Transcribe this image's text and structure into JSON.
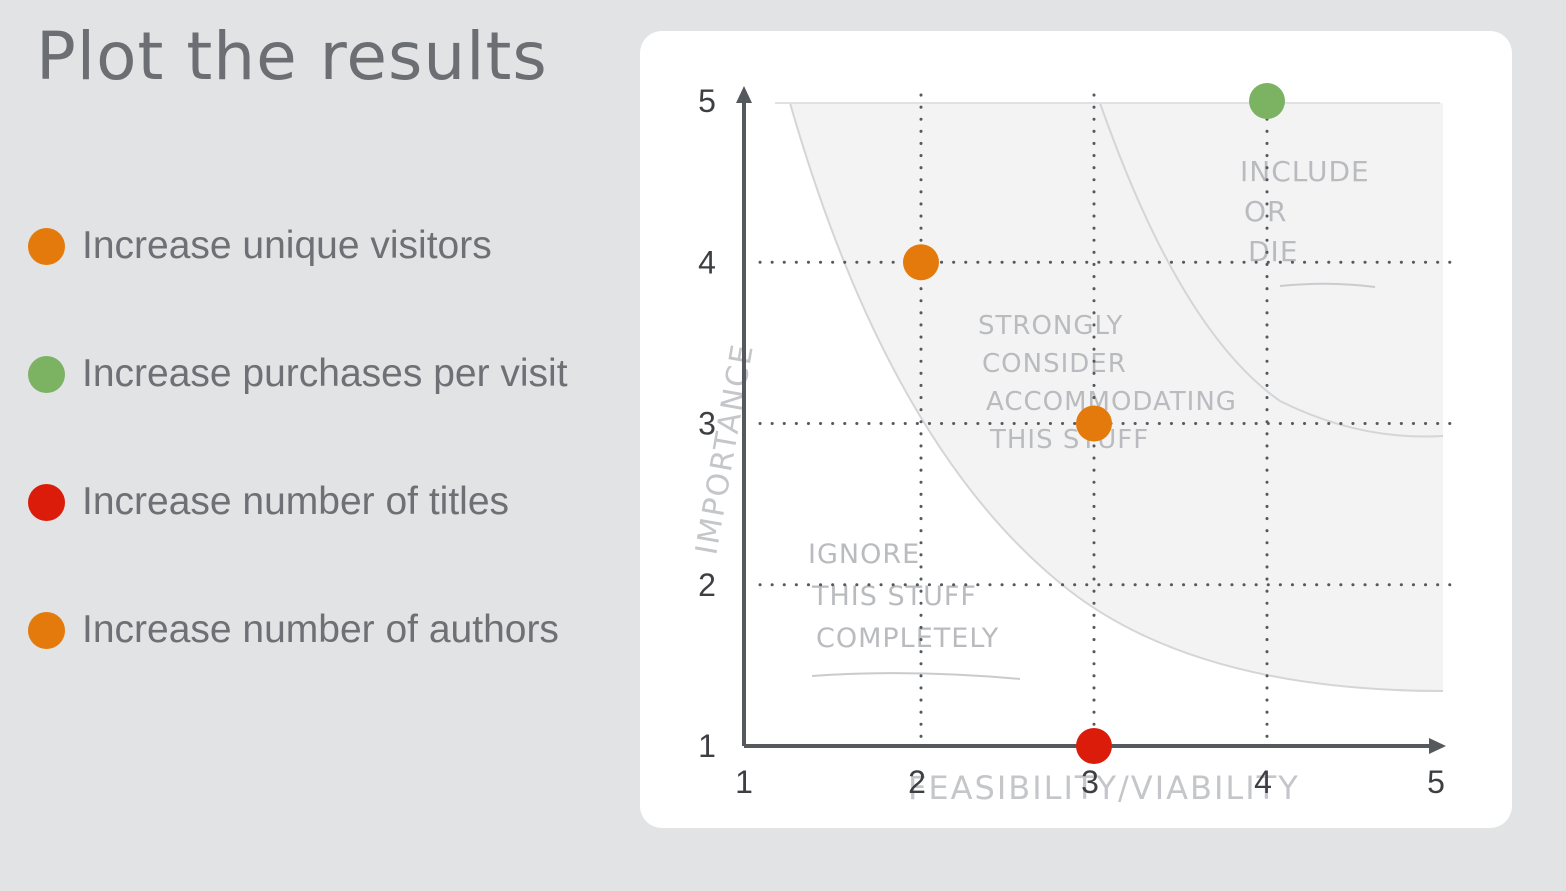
{
  "slide": {
    "title": "Plot the results"
  },
  "legend": [
    {
      "label": "Increase unique visitors",
      "color": "#e57a0c"
    },
    {
      "label": "Increase purchases per visit",
      "color": "#7cb363"
    },
    {
      "label": "Increase number of titles",
      "color": "#db1c0a"
    },
    {
      "label": "Increase number of authors",
      "color": "#e57a0c"
    }
  ],
  "chart_data": {
    "type": "scatter",
    "xlabel": "FEASIBILITY/VIABILITY",
    "ylabel": "IMPORTANCE",
    "xlim": [
      1,
      5
    ],
    "ylim": [
      1,
      5
    ],
    "x_ticks": [
      "1",
      "2",
      "3",
      "4",
      "5"
    ],
    "y_ticks": [
      "1",
      "2",
      "3",
      "4",
      "5"
    ],
    "grid": true,
    "grid_style": "dotted",
    "points": [
      {
        "label": "Increase unique visitors",
        "x": 2,
        "y": 4,
        "color": "#e57a0c"
      },
      {
        "label": "Increase purchases per visit",
        "x": 4,
        "y": 5,
        "color": "#7cb363"
      },
      {
        "label": "Increase number of titles",
        "x": 3,
        "y": 1,
        "color": "#db1c0a"
      },
      {
        "label": "Increase number of authors",
        "x": 3,
        "y": 3,
        "color": "#e57a0c"
      }
    ],
    "annotations": [
      {
        "text": "INCLUDE OR DIE",
        "lines": [
          "INCLUDE",
          "OR",
          "DIE"
        ]
      },
      {
        "text": "STRONGLY CONSIDER ACCOMMODATING THIS STUFF",
        "lines": [
          "STRONGLY",
          "CONSIDER",
          "ACCOMMODATING",
          "THIS STUFF"
        ]
      },
      {
        "text": "IGNORE THIS STUFF COMPLETELY",
        "lines": [
          "IGNORE",
          "THIS STUFF",
          "COMPLETELY"
        ]
      }
    ]
  }
}
